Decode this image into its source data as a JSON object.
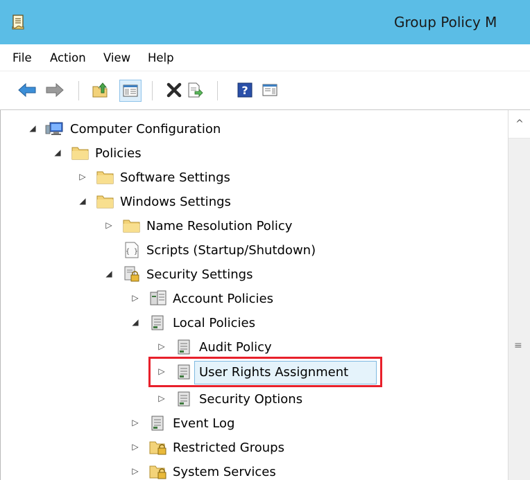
{
  "window": {
    "title": "Group Policy M"
  },
  "menu": [
    "File",
    "Action",
    "View",
    "Help"
  ],
  "toolbar": {
    "buttons": [
      "back-icon",
      "forward-icon",
      "up-folder-icon",
      "show-hide-tree-icon",
      "delete-icon",
      "export-list-icon",
      "help-icon",
      "properties-icon"
    ]
  },
  "tree": {
    "computer_configuration": "Computer Configuration",
    "policies": "Policies",
    "software_settings": "Software Settings",
    "windows_settings": "Windows Settings",
    "name_resolution_policy": "Name Resolution Policy",
    "scripts": "Scripts (Startup/Shutdown)",
    "security_settings": "Security Settings",
    "account_policies": "Account Policies",
    "local_policies": "Local Policies",
    "audit_policy": "Audit Policy",
    "user_rights_assignment": "User Rights Assignment",
    "security_options": "Security Options",
    "event_log": "Event Log",
    "restricted_groups": "Restricted Groups",
    "system_services": "System Services"
  },
  "colors": {
    "titlebar": "#5bbde6",
    "selection_fill": "#e5f3fb",
    "selection_border": "#7fb9e1",
    "highlight_annotation": "#e8202b"
  }
}
